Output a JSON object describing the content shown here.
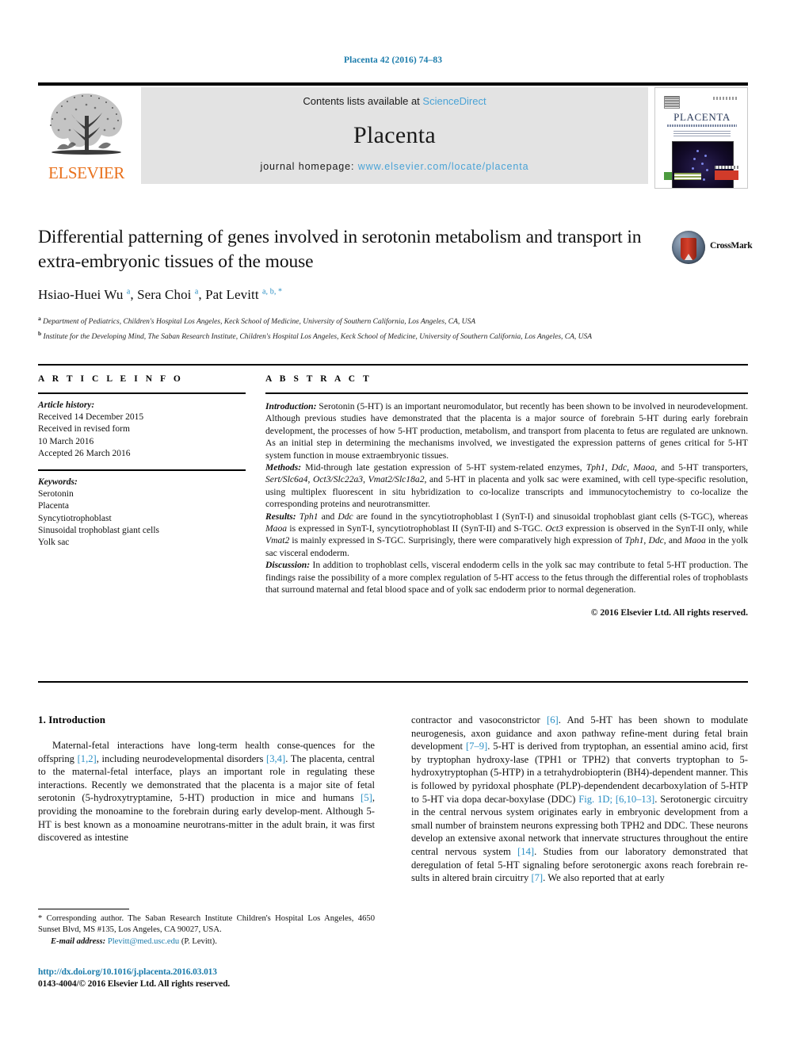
{
  "running_head": "Placenta 42 (2016) 74–83",
  "header": {
    "publisher_name": "ELSEVIER",
    "contents_prefix": "Contents lists available at ",
    "contents_link": "ScienceDirect",
    "journal_title": "Placenta",
    "homepage_prefix": "journal homepage: ",
    "homepage_link": "www.elsevier.com/locate/placenta",
    "cover_title": "PLACENTA"
  },
  "article": {
    "title": "Differential patterning of genes involved in serotonin metabolism and transport in extra-embryonic tissues of the mouse",
    "authors_html": "Hsiao-Huei Wu <sup>a</sup>, Sera Choi <sup>a</sup>, Pat Levitt <sup>a, b, *</sup>",
    "affiliation_a": "Department of Pediatrics, Children's Hospital Los Angeles, Keck School of Medicine, University of Southern California, Los Angeles, CA, USA",
    "affiliation_b": "Institute for the Developing Mind, The Saban Research Institute, Children's Hospital Los Angeles, Keck School of Medicine, University of Southern California, Los Angeles, CA, USA",
    "crossmark_label": "CrossMark"
  },
  "article_info": {
    "heading": "A R T I C L E  I N F O",
    "history_label": "Article history:",
    "history": [
      "Received 14 December 2015",
      "Received in revised form",
      "10 March 2016",
      "Accepted 26 March 2016"
    ],
    "keywords_label": "Keywords:",
    "keywords": [
      "Serotonin",
      "Placenta",
      "Syncytiotrophoblast",
      "Sinusoidal trophoblast giant cells",
      "Yolk sac"
    ]
  },
  "abstract": {
    "heading": "A B S T R A C T",
    "introduction_label": "Introduction:",
    "introduction_text": " Serotonin (5-HT) is an important neuromodulator, but recently has been shown to be involved in neurodevelopment. Although previous studies have demonstrated that the placenta is a major source of forebrain 5-HT during early forebrain development, the processes of how 5-HT production, metabolism, and transport from placenta to fetus are regulated are unknown. As an initial step in determining the mechanisms involved, we investigated the expression patterns of genes critical for 5-HT system function in mouse extraembryonic tissues.",
    "methods_label": "Methods:",
    "methods_text": " Mid-through late gestation expression of 5-HT system-related enzymes, Tph1, Ddc, Maoa, and 5-HT transporters, Sert/Slc6a4, Oct3/Slc22a3, Vmat2/Slc18a2, and 5-HT in placenta and yolk sac were examined, with cell type-specific resolution, using multiplex fluorescent in situ hybridization to co-localize transcripts and immunocytochemistry to co-localize the corresponding proteins and neurotransmitter.",
    "results_label": "Results:",
    "results_text": " Tph1 and Ddc are found in the syncytiotrophoblast I (SynT-I) and sinusoidal trophoblast giant cells (S-TGC), whereas Maoa is expressed in SynT-I, syncytiotrophoblast II (SynT-II) and S-TGC. Oct3 expression is observed in the SynT-II only, while Vmat2 is mainly expressed in S-TGC. Surprisingly, there were comparatively high expression of Tph1, Ddc, and Maoa in the yolk sac visceral endoderm.",
    "discussion_label": "Discussion:",
    "discussion_text": " In addition to trophoblast cells, visceral endoderm cells in the yolk sac may contribute to fetal 5-HT production. The findings raise the possibility of a more complex regulation of 5-HT access to the fetus through the differential roles of trophoblasts that surround maternal and fetal blood space and of yolk sac endoderm prior to normal degeneration.",
    "copyright": "© 2016 Elsevier Ltd. All rights reserved."
  },
  "body": {
    "section_number_title": "1.  Introduction",
    "left_paragraph_parts": [
      "Maternal-fetal interactions have long-term health conse-quences for the offspring ",
      "[1,2]",
      ", including neurodevelopmental disorders ",
      "[3,4]",
      ". The placenta, central to the maternal-fetal interface, plays an important role in regulating these interactions. Recently we demonstrated that the placenta is a major site of fetal serotonin (5-hydroxytryptamine, 5-HT) production in mice and humans ",
      "[5]",
      ", providing the monoamine to the forebrain during early develop-ment. Although 5-HT is best known as a monoamine neurotrans-mitter in the adult brain, it was first discovered as intestine"
    ],
    "right_paragraph_parts": [
      "contractor and vasoconstrictor ",
      "[6]",
      ". And 5-HT has been shown to modulate neurogenesis, axon guidance and axon pathway refine-ment during fetal brain development ",
      "[7–9]",
      ". 5-HT is derived from tryptophan, an essential amino acid, first by tryptophan hydroxy-lase (TPH1 or TPH2) that converts tryptophan to 5-hydroxytryptophan (5-HTP) in a tetrahydrobiopterin (BH4)-dependent manner. This is followed by pyridoxal phosphate (PLP)-dependendent decarboxylation of 5-HTP to 5-HT via dopa decar-boxylase (DDC) ",
      "Fig. 1D; [6,10–13]",
      ". Serotonergic circuitry in the central nervous system originates early in embryonic development from a small number of brainstem neurons expressing both TPH2 and DDC. These neurons develop an extensive axonal network that innervate structures throughout the entire central nervous system ",
      "[14]",
      ". Studies from our laboratory demonstrated that deregulation of fetal 5-HT signaling before serotonergic axons reach forebrain re-sults in altered brain circuitry ",
      "[7]",
      ". We also reported that at early"
    ]
  },
  "footer": {
    "corresponding_marker": "*",
    "corresponding_text": " Corresponding author. The Saban Research Institute Children's Hospital Los Angeles, 4650 Sunset Blvd, MS #135, Los Angeles, CA 90027, USA.",
    "email_label": "E-mail address:",
    "email": "Plevitt@med.usc.edu",
    "email_suffix": " (P. Levitt).",
    "doi": "http://dx.doi.org/10.1016/j.placenta.2016.03.013",
    "issn_line": "0143-4004/© 2016 Elsevier Ltd. All rights reserved."
  },
  "colors": {
    "link_blue": "#4aa3d6",
    "ref_blue": "#2a8fc4",
    "head_blue": "#1a7bab",
    "elsevier_orange": "#E9711C",
    "band_gray": "#e3e3e3"
  }
}
